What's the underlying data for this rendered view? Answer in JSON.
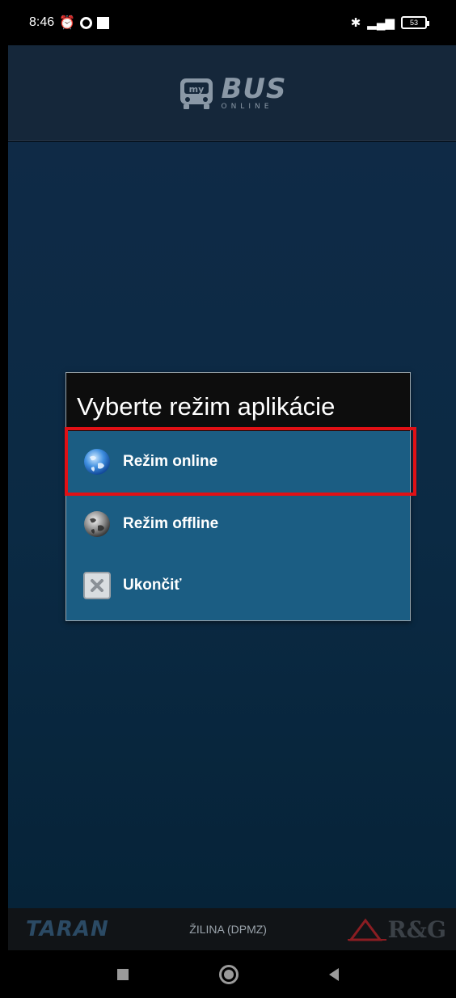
{
  "status_bar": {
    "time": "8:46",
    "battery": "53"
  },
  "app": {
    "logo_badge": "my",
    "logo_bus": "BUS",
    "logo_online": "ONLINE"
  },
  "dialog": {
    "title": "Vyberte režim aplikácie",
    "options": [
      {
        "label": "Režim online",
        "icon": "globe-icon",
        "highlighted": true
      },
      {
        "label": "Režim offline",
        "icon": "globe-offline-icon",
        "highlighted": false
      },
      {
        "label": "Ukončiť",
        "icon": "close-icon",
        "highlighted": false
      }
    ]
  },
  "footer": {
    "left_logo": "TARAN",
    "region": "ŽILINA (DPMZ)",
    "right_logo": "R&G"
  },
  "colors": {
    "dialog_bg": "#1b5d83",
    "highlight": "#e11015",
    "header_bg": "#15273a"
  }
}
